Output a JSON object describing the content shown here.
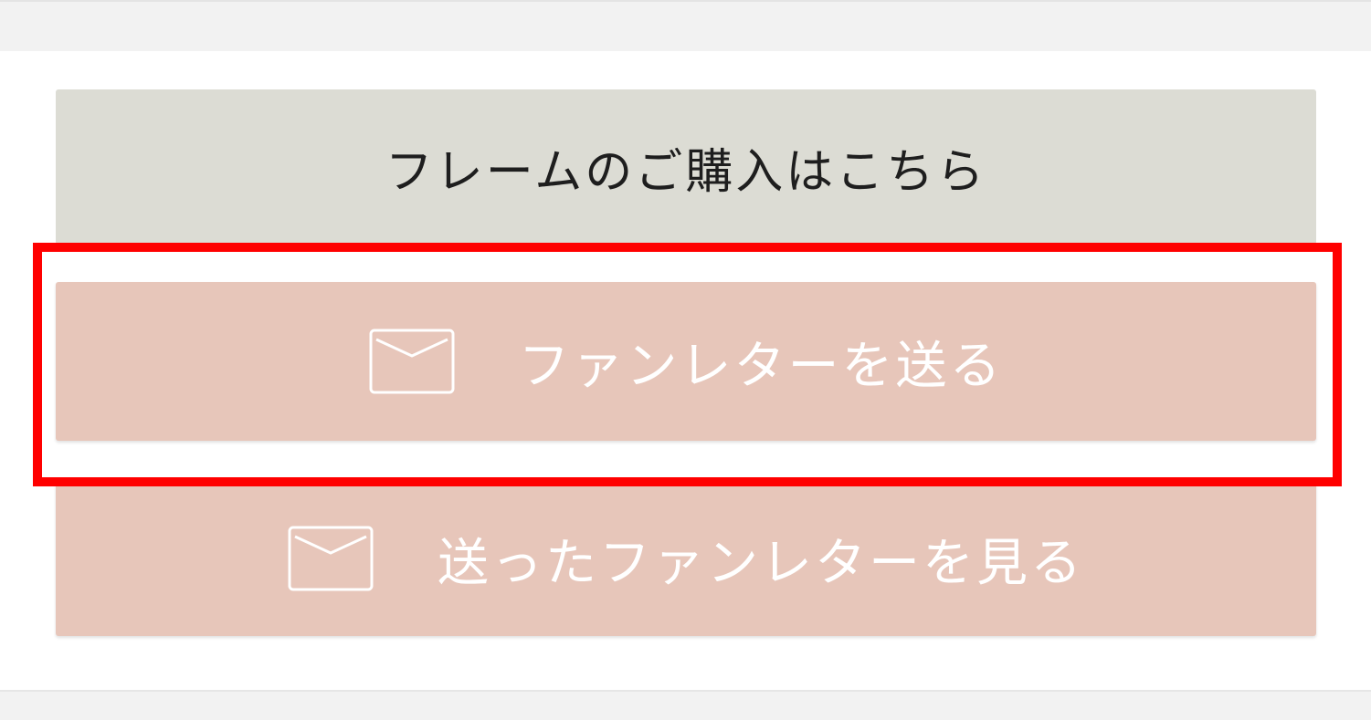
{
  "buttons": {
    "frame_purchase_label": "フレームのご購入はこちら",
    "send_fan_letter_label": "ファンレターを送る",
    "view_sent_fan_letters_label": "送ったファンレターを見る"
  },
  "icons": {
    "send_icon": "mail-icon",
    "view_icon": "mail-icon"
  },
  "colors": {
    "frame_button_bg": "#dcdcd4",
    "fan_letter_button_bg": "#e7c6ba",
    "highlight_border": "#ff0000"
  }
}
